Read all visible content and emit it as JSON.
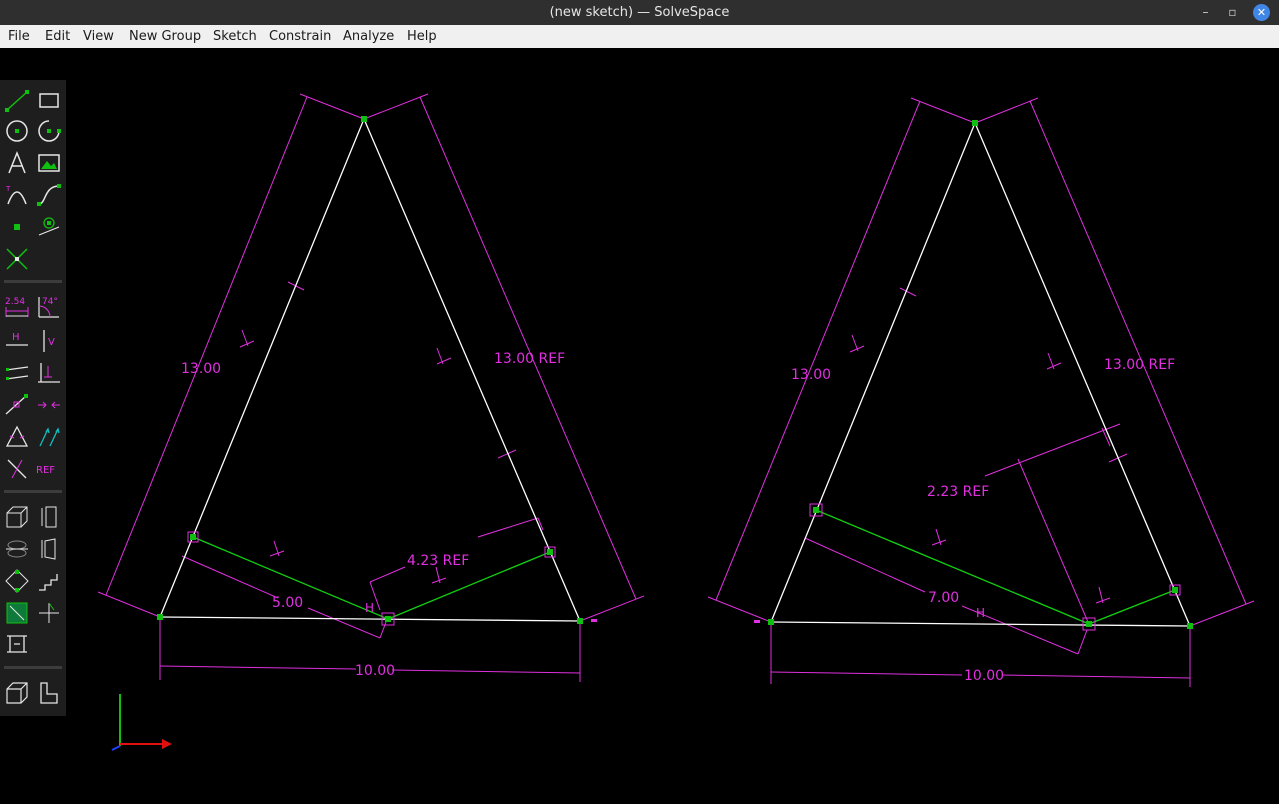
{
  "window": {
    "title": "(new sketch) — SolveSpace",
    "minimize": "–",
    "maximize": "▫",
    "close": "✕"
  },
  "menu": [
    "File",
    "Edit",
    "View",
    "New Group",
    "Sketch",
    "Constrain",
    "Analyze",
    "Help"
  ],
  "toolbar": {
    "distance_label": "2.54",
    "angle_label": "74°",
    "horizontal_label": "H",
    "vertical_label": "V",
    "ref_label": "REF"
  },
  "sketch_left": {
    "dim_left_side": "13.00",
    "dim_right_side": "13.00  REF",
    "dim_bottom": "10.00",
    "dim_green_left": "5.00",
    "dim_green_right": "4.23  REF",
    "horizontal_marker": "H"
  },
  "sketch_right": {
    "dim_left_side": "13.00",
    "dim_right_side": "13.00  REF",
    "dim_bottom": "10.00",
    "dim_green_left": "7.00",
    "dim_green_right": "2.23  REF",
    "horizontal_marker": "H"
  },
  "colors": {
    "constraint": "#e030e0",
    "line": "#ffffff",
    "construction": "#10d010",
    "point": "#10c010",
    "axis_x": "#e01010",
    "axis_y": "#10c010",
    "axis_z": "#2040ff"
  }
}
